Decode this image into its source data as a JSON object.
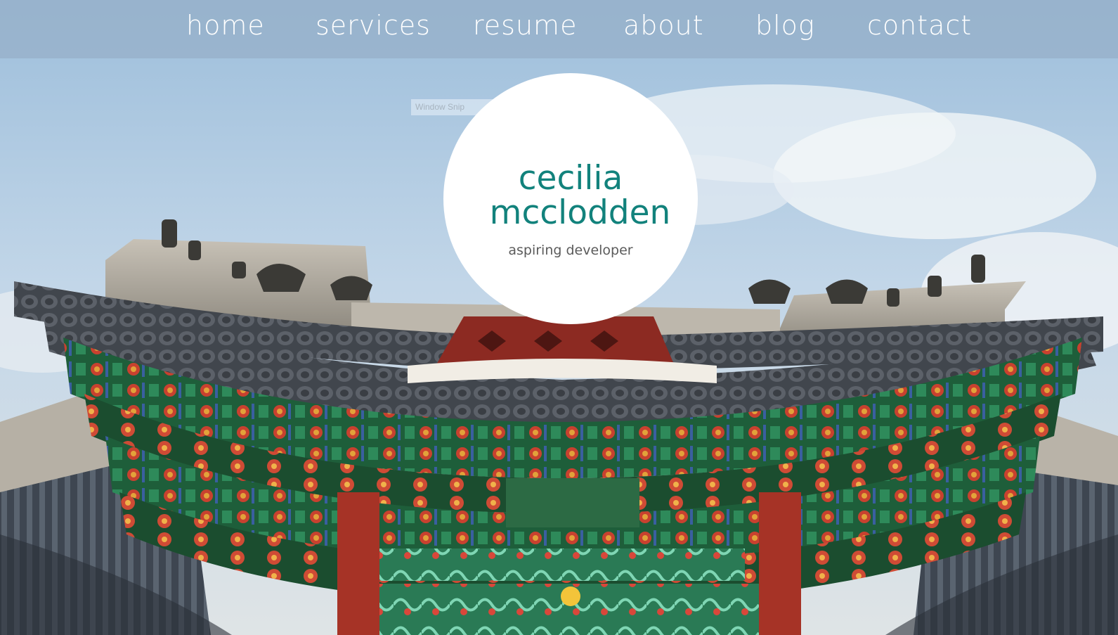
{
  "nav": {
    "items": [
      {
        "label": "home"
      },
      {
        "label": "services"
      },
      {
        "label": "resume"
      },
      {
        "label": "about"
      },
      {
        "label": "blog"
      },
      {
        "label": "contact"
      }
    ]
  },
  "overlay": {
    "window_snip_label": "Window Snip"
  },
  "profile": {
    "first_name": "cecilia",
    "last_name": "mcclodden",
    "tagline": "aspiring developer"
  },
  "colors": {
    "navbar": "#96afc8",
    "name_teal": "#12827c",
    "tagline_gray": "#5b5b5b",
    "roof_green": "#1f6b3d",
    "roof_red": "#b23a2a"
  },
  "background": {
    "icon": "korean-palace-roof-photo"
  }
}
